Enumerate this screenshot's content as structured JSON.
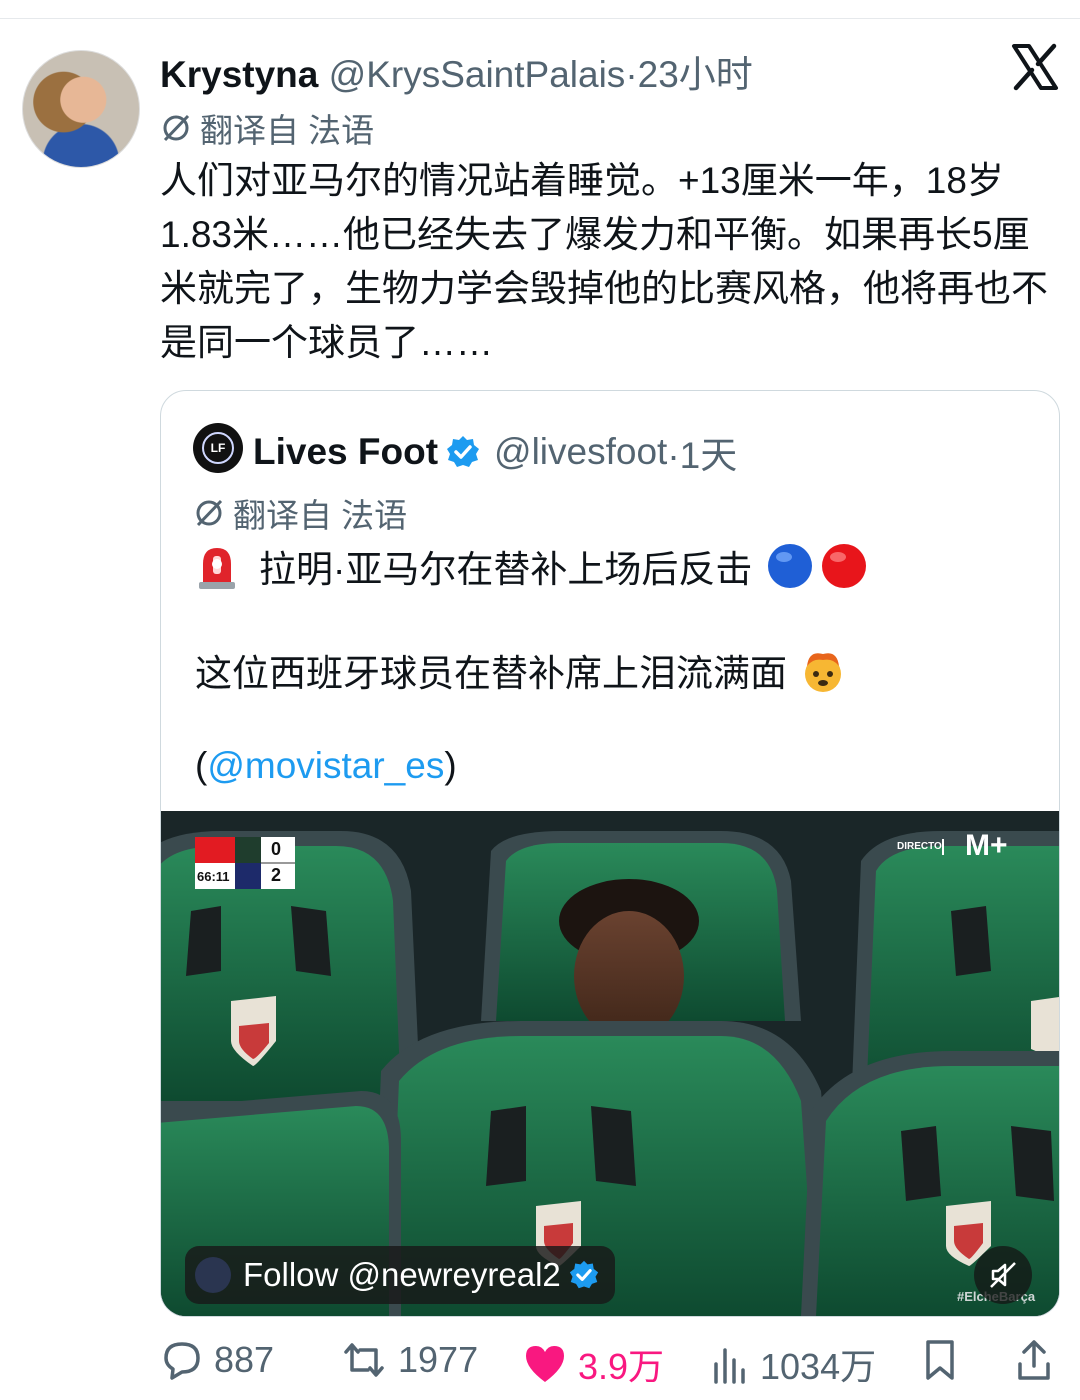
{
  "tweet": {
    "author_name": "Krystyna",
    "author_handle": "@KrysSaintPalais",
    "time": "·23小时",
    "translated_label": "翻译自 法语",
    "text": "人们对亚马尔的情况站着睡觉。+13厘米一年，18岁 1.83米……他已经失去了爆发力和平衡。如果再长5厘米就完了，生物力学会毁掉他的比赛风格，他将再也不是同一个球员了……"
  },
  "quoted": {
    "author_name": "Lives Foot",
    "author_handle": "@livesfoot",
    "time": "·1天",
    "translated_label": "翻译自 法语",
    "line1": "拉明·亚马尔在替补上场后反击",
    "line2": "这位西班牙球员在替补席上泪流满面",
    "line3_open": "(",
    "line3_mention": "@movistar_es",
    "line3_close": ")",
    "media": {
      "score_home": "0",
      "score_away": "2",
      "clock": "66:11",
      "broadcaster_label": "DIRECTO",
      "broadcaster_logo": "M+",
      "hashtag": "#ElcheBarça",
      "follow_text": "Follow @newreyreal2"
    }
  },
  "actions": {
    "replies": "887",
    "reposts": "1977",
    "likes": "3.9万",
    "views": "1034万"
  },
  "colors": {
    "accent_blue": "#1d9bf0",
    "like_pink": "#f91880",
    "muted_gray": "#536471"
  }
}
